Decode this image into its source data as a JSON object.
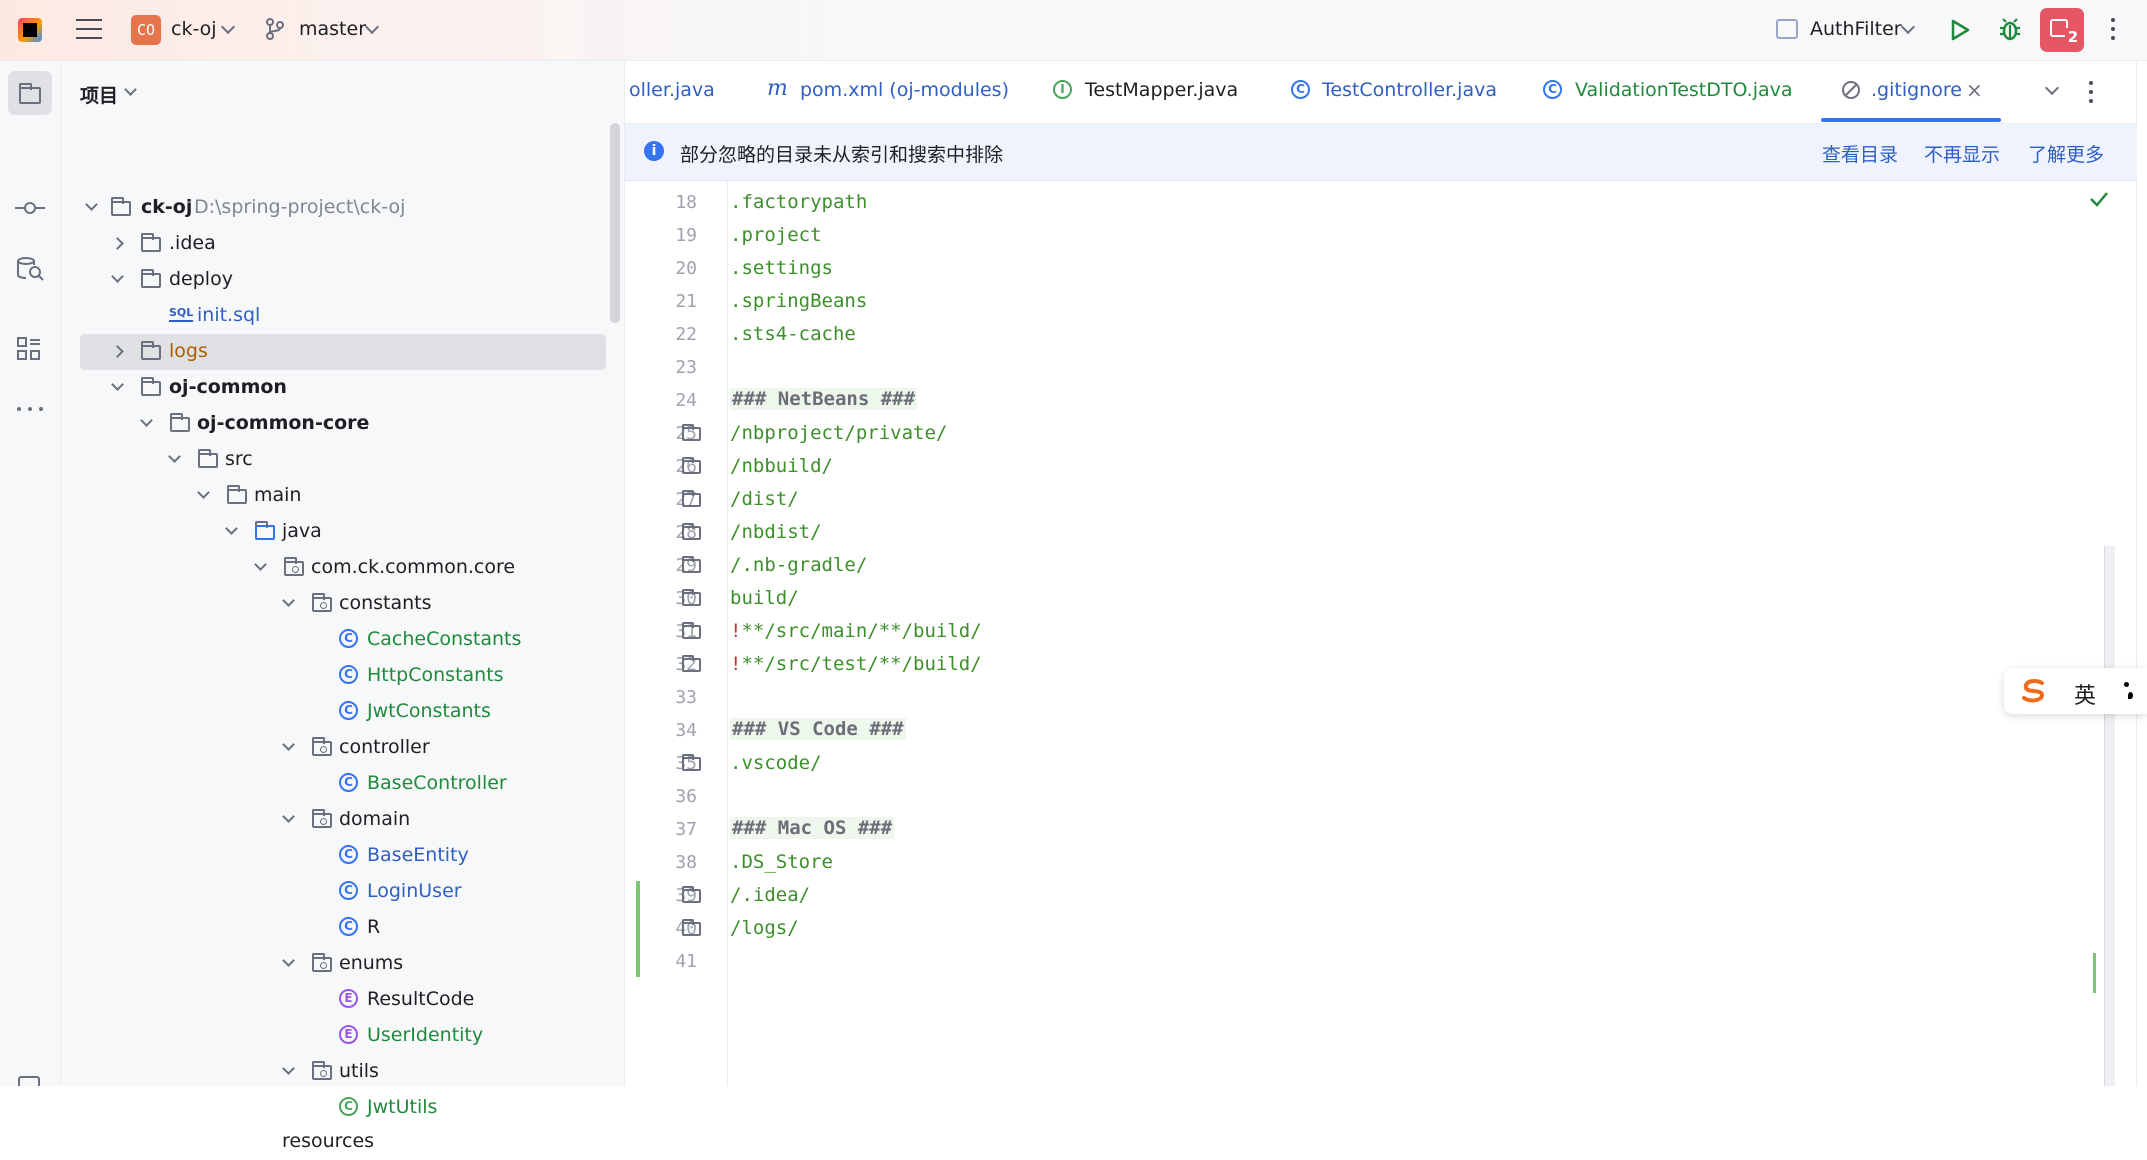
{
  "titlebar": {
    "project_badge": "CO",
    "project_name": "ck-oj",
    "branch": "master",
    "run_config": "AuthFilter",
    "notification_count": "2"
  },
  "project_panel": {
    "title": "项目",
    "tree": [
      {
        "label": "ck-oj",
        "path": "D:\\spring-project\\ck-oj"
      },
      {
        "label": ".idea"
      },
      {
        "label": "deploy"
      },
      {
        "label": "init.sql",
        "icon_text": "SQL"
      },
      {
        "label": "logs"
      },
      {
        "label": "oj-common"
      },
      {
        "label": "oj-common-core"
      },
      {
        "label": "src"
      },
      {
        "label": "main"
      },
      {
        "label": "java"
      },
      {
        "label": "com.ck.common.core"
      },
      {
        "label": "constants"
      },
      {
        "label": "CacheConstants"
      },
      {
        "label": "HttpConstants"
      },
      {
        "label": "JwtConstants"
      },
      {
        "label": "controller"
      },
      {
        "label": "BaseController"
      },
      {
        "label": "domain"
      },
      {
        "label": "BaseEntity"
      },
      {
        "label": "LoginUser"
      },
      {
        "label": "R"
      },
      {
        "label": "enums"
      },
      {
        "label": "ResultCode"
      },
      {
        "label": "UserIdentity"
      },
      {
        "label": "utils"
      },
      {
        "label": "JwtUtils"
      },
      {
        "label": "resources"
      }
    ]
  },
  "tabs": [
    {
      "label": "oller.java"
    },
    {
      "label": "pom.xml (oj-modules)",
      "icon_text": "m"
    },
    {
      "label": "TestMapper.java",
      "icon_text": "I"
    },
    {
      "label": "TestController.java",
      "icon_text": "C"
    },
    {
      "label": "ValidationTestDTO.java",
      "icon_text": "C"
    },
    {
      "label": ".gitignore",
      "active": true
    }
  ],
  "banner": {
    "message": "部分忽略的目录未从索引和搜索中排除",
    "actions": [
      "查看目录",
      "不再显示",
      "了解更多"
    ]
  },
  "editor": {
    "lines": [
      {
        "n": "18",
        "text": ".factorypath"
      },
      {
        "n": "19",
        "text": ".project"
      },
      {
        "n": "20",
        "text": ".settings"
      },
      {
        "n": "21",
        "text": ".springBeans"
      },
      {
        "n": "22",
        "text": ".sts4-cache"
      },
      {
        "n": "23",
        "text": ""
      },
      {
        "n": "24",
        "text": "### NetBeans ###"
      },
      {
        "n": "25",
        "text": "/nbproject/private/"
      },
      {
        "n": "26",
        "text": "/nbbuild/"
      },
      {
        "n": "27",
        "text": "/dist/"
      },
      {
        "n": "28",
        "text": "/nbdist/"
      },
      {
        "n": "29",
        "text": "/.nb-gradle/"
      },
      {
        "n": "30",
        "text": "build/"
      },
      {
        "n": "31",
        "text": "!",
        "rest": "**/src/main/**/build/"
      },
      {
        "n": "32",
        "text": "!",
        "rest": "**/src/test/**/build/"
      },
      {
        "n": "33",
        "text": ""
      },
      {
        "n": "34",
        "text": "### VS Code ###"
      },
      {
        "n": "35",
        "text": ".vscode/"
      },
      {
        "n": "36",
        "text": ""
      },
      {
        "n": "37",
        "text": "### Mac OS ###"
      },
      {
        "n": "38",
        "text": ".DS_Store"
      },
      {
        "n": "39",
        "text": "/.idea/"
      },
      {
        "n": "40",
        "text": "/logs/"
      },
      {
        "n": "41",
        "text": ""
      }
    ]
  },
  "ime": {
    "lang": "英"
  },
  "colors": {
    "accent": "#3574f0",
    "string_green": "#3d8f2a",
    "badge_red": "#e55765"
  }
}
